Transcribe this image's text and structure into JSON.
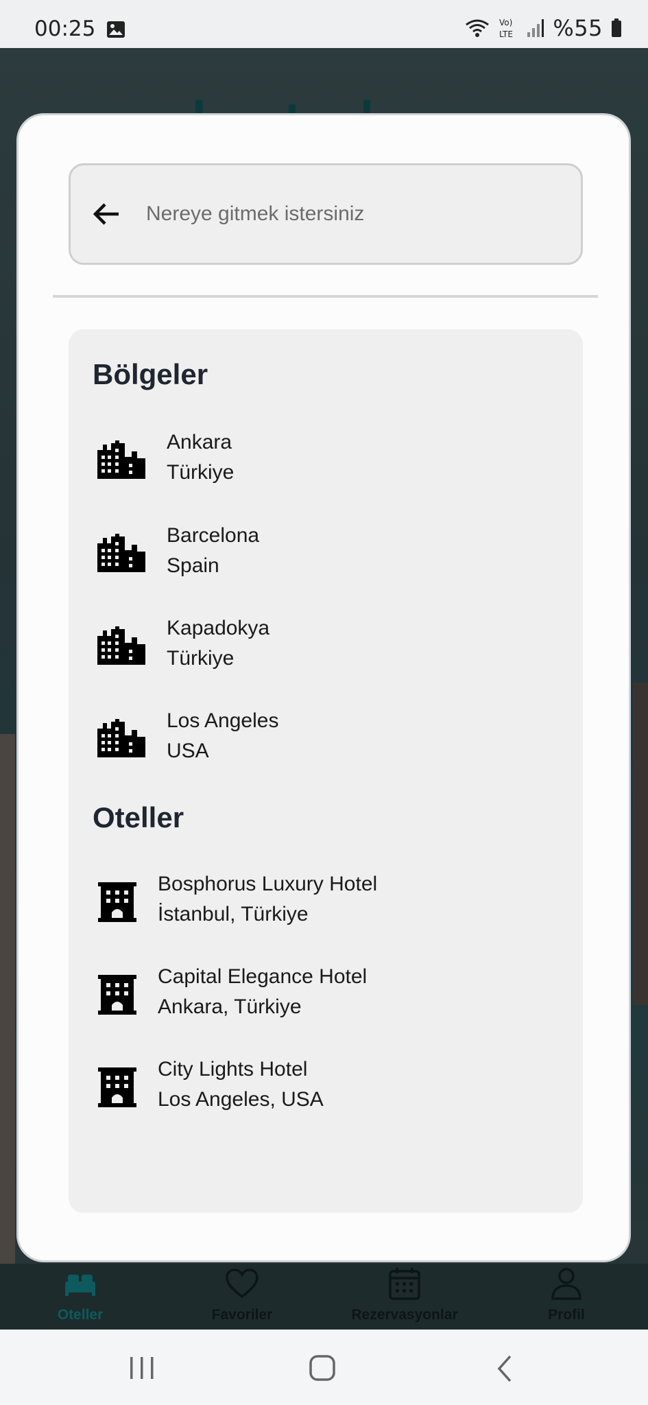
{
  "status_bar": {
    "time": "00:25",
    "battery": "%55",
    "icons": [
      "image-icon",
      "wifi-icon",
      "volte-icon",
      "signal-icon",
      "battery-icon"
    ]
  },
  "background": {
    "logo_part1": "hotel",
    "logo_part2": "rez"
  },
  "search": {
    "placeholder": "Nereye gitmek istersiniz",
    "value": ""
  },
  "regions": {
    "title": "Bölgeler",
    "items": [
      {
        "name": "Ankara",
        "country": "Türkiye"
      },
      {
        "name": "Barcelona",
        "country": "Spain"
      },
      {
        "name": "Kapadokya",
        "country": "Türkiye"
      },
      {
        "name": "Los Angeles",
        "country": "USA"
      }
    ]
  },
  "hotels": {
    "title": "Oteller",
    "items": [
      {
        "name": "Bosphorus Luxury Hotel",
        "location": "İstanbul, Türkiye"
      },
      {
        "name": "Capital Elegance Hotel",
        "location": "Ankara, Türkiye"
      },
      {
        "name": "City Lights Hotel",
        "location": "Los Angeles, USA"
      }
    ]
  },
  "bottom_nav": {
    "items": [
      {
        "label": "Oteller",
        "icon": "bed-icon",
        "active": true
      },
      {
        "label": "Favoriler",
        "icon": "heart-icon",
        "active": false
      },
      {
        "label": "Rezervasyonlar",
        "icon": "calendar-icon",
        "active": false
      },
      {
        "label": "Profil",
        "icon": "person-icon",
        "active": false
      }
    ]
  },
  "colors": {
    "accent": "#0e5a5e",
    "modal_bg": "#fcfcfc",
    "panel_bg": "#efefef"
  }
}
